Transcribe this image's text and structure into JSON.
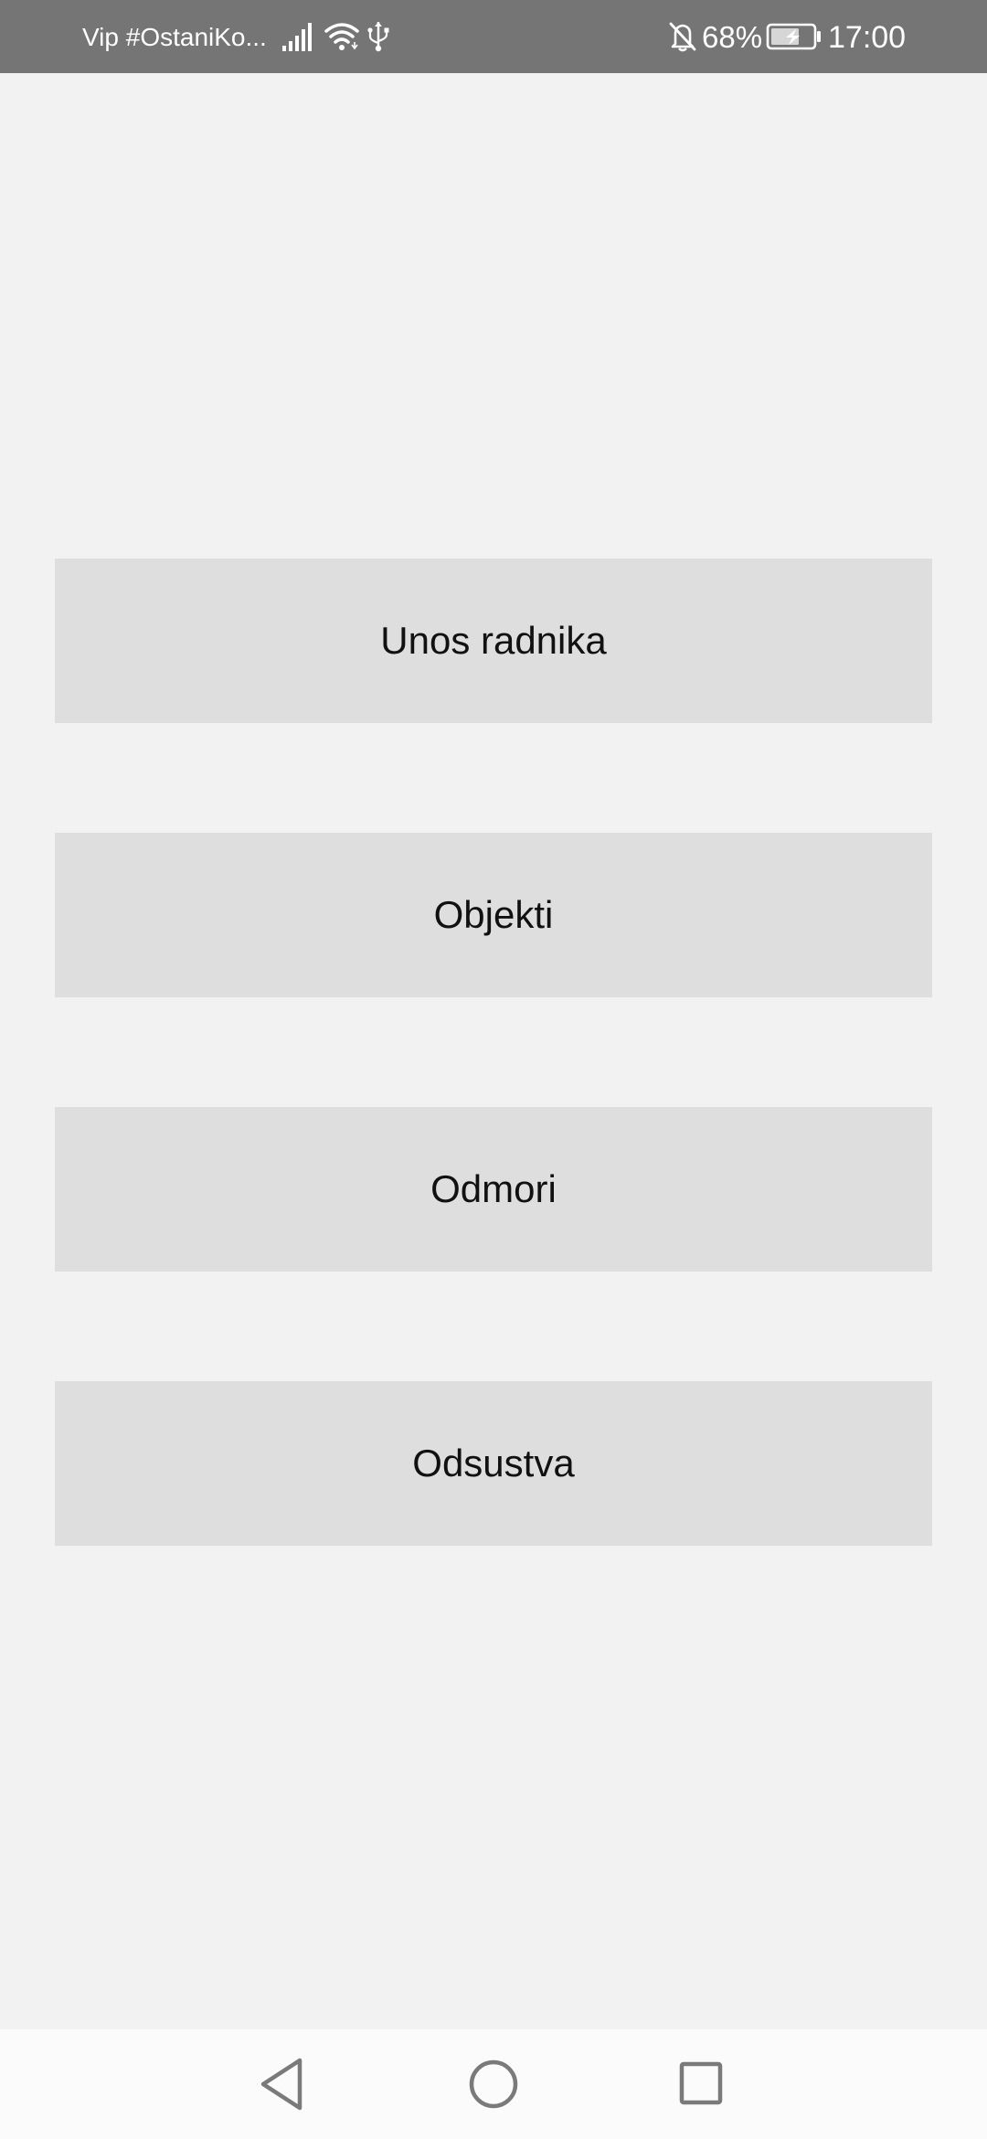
{
  "status_bar": {
    "carrier": "Vip #OstaniKo...",
    "battery_percent": "68%",
    "time": "17:00",
    "icons": [
      "signal-icon",
      "wifi-icon",
      "usb-icon",
      "bell-off-icon",
      "battery-charging-icon"
    ]
  },
  "menu": {
    "buttons": [
      {
        "label": "Unos radnika"
      },
      {
        "label": "Objekti"
      },
      {
        "label": "Odmori"
      },
      {
        "label": "Odsustva"
      }
    ]
  },
  "nav_bar": {
    "icons": [
      "back-icon",
      "home-icon",
      "recents-icon"
    ]
  },
  "colors": {
    "status_bar_bg": "#757575",
    "page_bg": "#f2f2f2",
    "button_bg": "#dedede",
    "nav_bar_bg": "#fbfbfb",
    "nav_icon": "#7a7a7a"
  }
}
